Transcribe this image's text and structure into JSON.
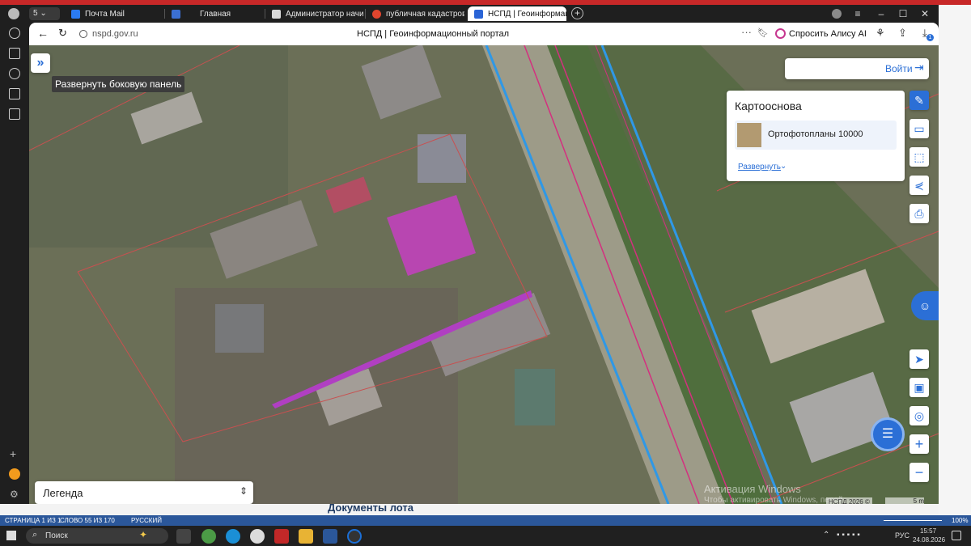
{
  "browser": {
    "tabs": [
      {
        "label": "Почта Mail",
        "color": "#2b7bf2"
      },
      {
        "label": "Главная",
        "color": "#3b6fd1"
      },
      {
        "label": "Администратор начисле",
        "color": "#d9d9d9"
      },
      {
        "label": "публичная кадастровая к",
        "color": "#e0452e"
      },
      {
        "label": "НСПД | Геоинформаци",
        "color": "#2a64d6",
        "active": true
      }
    ],
    "url": "nspd.gov.ru",
    "page_title": "НСПД | Геоинформационный портал",
    "alice": "Спросить Алису AI",
    "badge": "1"
  },
  "map": {
    "expand_tooltip": "Развернуть боковую панель",
    "login": "Войти",
    "basemap": {
      "title": "Картооснова",
      "item": "Ортофотопланы 10000",
      "expand": "Развернуть"
    },
    "legend": "Легенда",
    "watermark_title": "Активация Windows",
    "watermark_sub": "Чтобы активировать Windows, перей",
    "copyright": "НСПД 2026 ©",
    "scale": "5 m"
  },
  "document": {
    "heading": "Документы лота"
  },
  "statusbar": {
    "page": "СТРАНИЦА 1 ИЗ 1",
    "words": "СЛОВО 55 ИЗ 170",
    "lang": "РУССКИЙ",
    "zoom": "100%"
  },
  "taskbar": {
    "search": "Поиск",
    "lang": "РУС",
    "time": "15:57",
    "date": "24.08.2026"
  }
}
